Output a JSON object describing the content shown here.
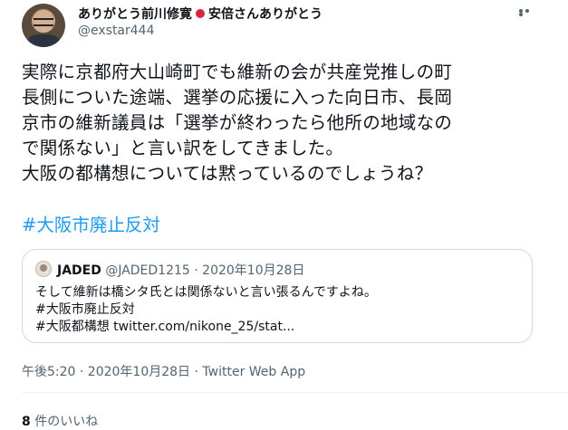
{
  "author": {
    "display_name_a": "ありがとう前川修寛",
    "display_name_b": "安倍さんありがとう",
    "handle": "@exstar444",
    "flag_color": "#d7263d"
  },
  "tweet": {
    "lines": [
      "実際に京都府大山崎町でも維新の会が共産党推しの町",
      "長側についた途端、選挙の応援に入った向日市、長岡",
      "京市の維新議員は「選挙が終わったら他所の地域なの",
      "で関係ない」と言い訳をしてきました。",
      "大阪の都構想については黙っているのでしょうね？"
    ],
    "hashtag": "#大阪市廃止反対",
    "timestamp": "午後5:20 · 2020年10月28日 · Twitter Web App"
  },
  "quoted": {
    "name": "JADED",
    "meta": "@JADED1215 · 2020年10月28日",
    "lines": [
      "そして維新は橋シタ氏とは関係ないと言い張るんですよね。",
      "#大阪市廃止反対",
      "#大阪都構想 twitter.com/nikone_25/stat..."
    ]
  },
  "stats": {
    "likes_count": "8",
    "likes_label": "件のいいね"
  },
  "icons": {
    "more": "more-horizontal-icon",
    "avatar": "avatar"
  },
  "colors": {
    "link": "#1d9bf0",
    "secondary_text": "#536471",
    "border": "#cfd9de"
  }
}
